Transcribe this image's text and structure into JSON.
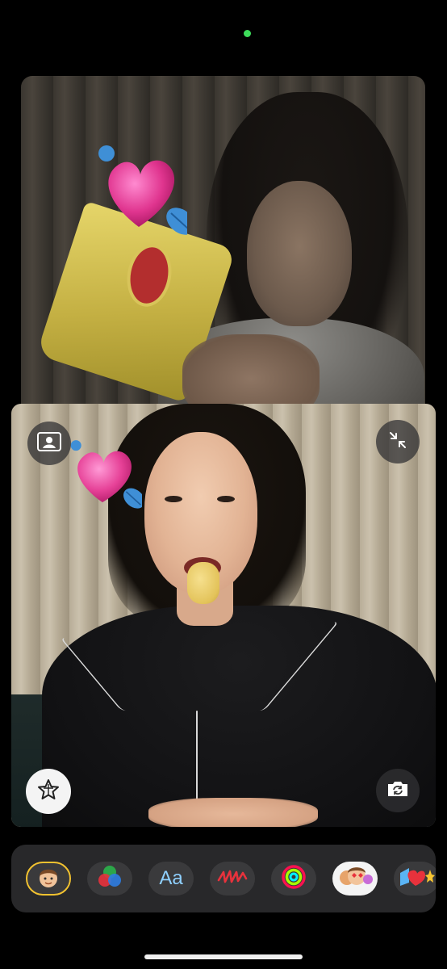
{
  "status": {
    "camera_active_color": "#3ddc5a"
  },
  "remote_tile": {
    "participant": "remote caller",
    "sticker": "heart-with-bird-memoji-sticker"
  },
  "local_tile": {
    "sticker": "heart-with-bird-memoji-sticker",
    "buttons": {
      "contact_card_icon": "person-card-icon",
      "minimize_icon": "minimize-arrows-icon",
      "effects_icon": "star-effects-icon",
      "flip_camera_icon": "flip-camera-icon"
    }
  },
  "effects_tray": {
    "items": [
      {
        "id": "memoji",
        "icon": "memoji-face-icon",
        "selected": true
      },
      {
        "id": "filters",
        "icon": "color-filters-icon"
      },
      {
        "id": "text",
        "label": "Aa"
      },
      {
        "id": "shapes",
        "icon": "scribble-shapes-icon"
      },
      {
        "id": "activity",
        "icon": "activity-rings-icon"
      },
      {
        "id": "memoji-stickers",
        "icon": "memoji-stickers-icon"
      },
      {
        "id": "emoji-stickers",
        "icon": "emoji-stickers-icon"
      }
    ]
  }
}
